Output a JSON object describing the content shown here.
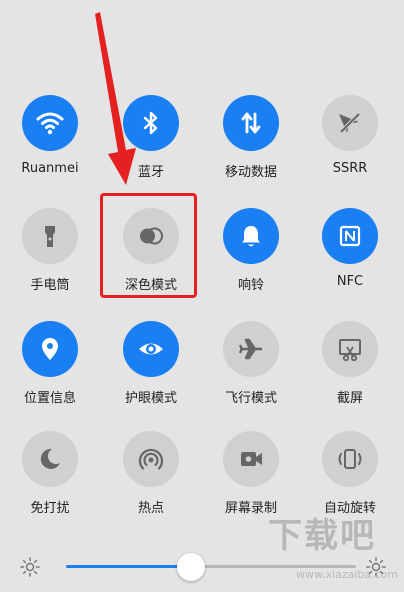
{
  "colors": {
    "accent": "#1a7ff3",
    "inactive": "#d0d0d0",
    "highlight": "#e52020"
  },
  "tiles": [
    {
      "label": "Ruanmei",
      "icon": "wifi-icon",
      "on": true
    },
    {
      "label": "蓝牙",
      "icon": "bluetooth-icon",
      "on": true
    },
    {
      "label": "移动数据",
      "icon": "mobile-data-icon",
      "on": true
    },
    {
      "label": "SSRR",
      "icon": "vpn-off-icon",
      "on": false
    },
    {
      "label": "手电筒",
      "icon": "flashlight-icon",
      "on": false
    },
    {
      "label": "深色模式",
      "icon": "dark-mode-icon",
      "on": false
    },
    {
      "label": "响铃",
      "icon": "bell-icon",
      "on": true
    },
    {
      "label": "NFC",
      "icon": "nfc-icon",
      "on": true
    },
    {
      "label": "位置信息",
      "icon": "location-icon",
      "on": true
    },
    {
      "label": "护眼模式",
      "icon": "eye-icon",
      "on": true
    },
    {
      "label": "飞行模式",
      "icon": "airplane-icon",
      "on": false
    },
    {
      "label": "截屏",
      "icon": "screenshot-icon",
      "on": false
    },
    {
      "label": "免打扰",
      "icon": "moon-icon",
      "on": false
    },
    {
      "label": "热点",
      "icon": "hotspot-icon",
      "on": false
    },
    {
      "label": "屏幕录制",
      "icon": "screen-record-icon",
      "on": false
    },
    {
      "label": "自动旋转",
      "icon": "auto-rotate-icon",
      "on": false
    }
  ],
  "brightness": {
    "level": 0.43
  },
  "watermark": {
    "text": "下载吧",
    "url": "www.xiazaiba.com"
  }
}
